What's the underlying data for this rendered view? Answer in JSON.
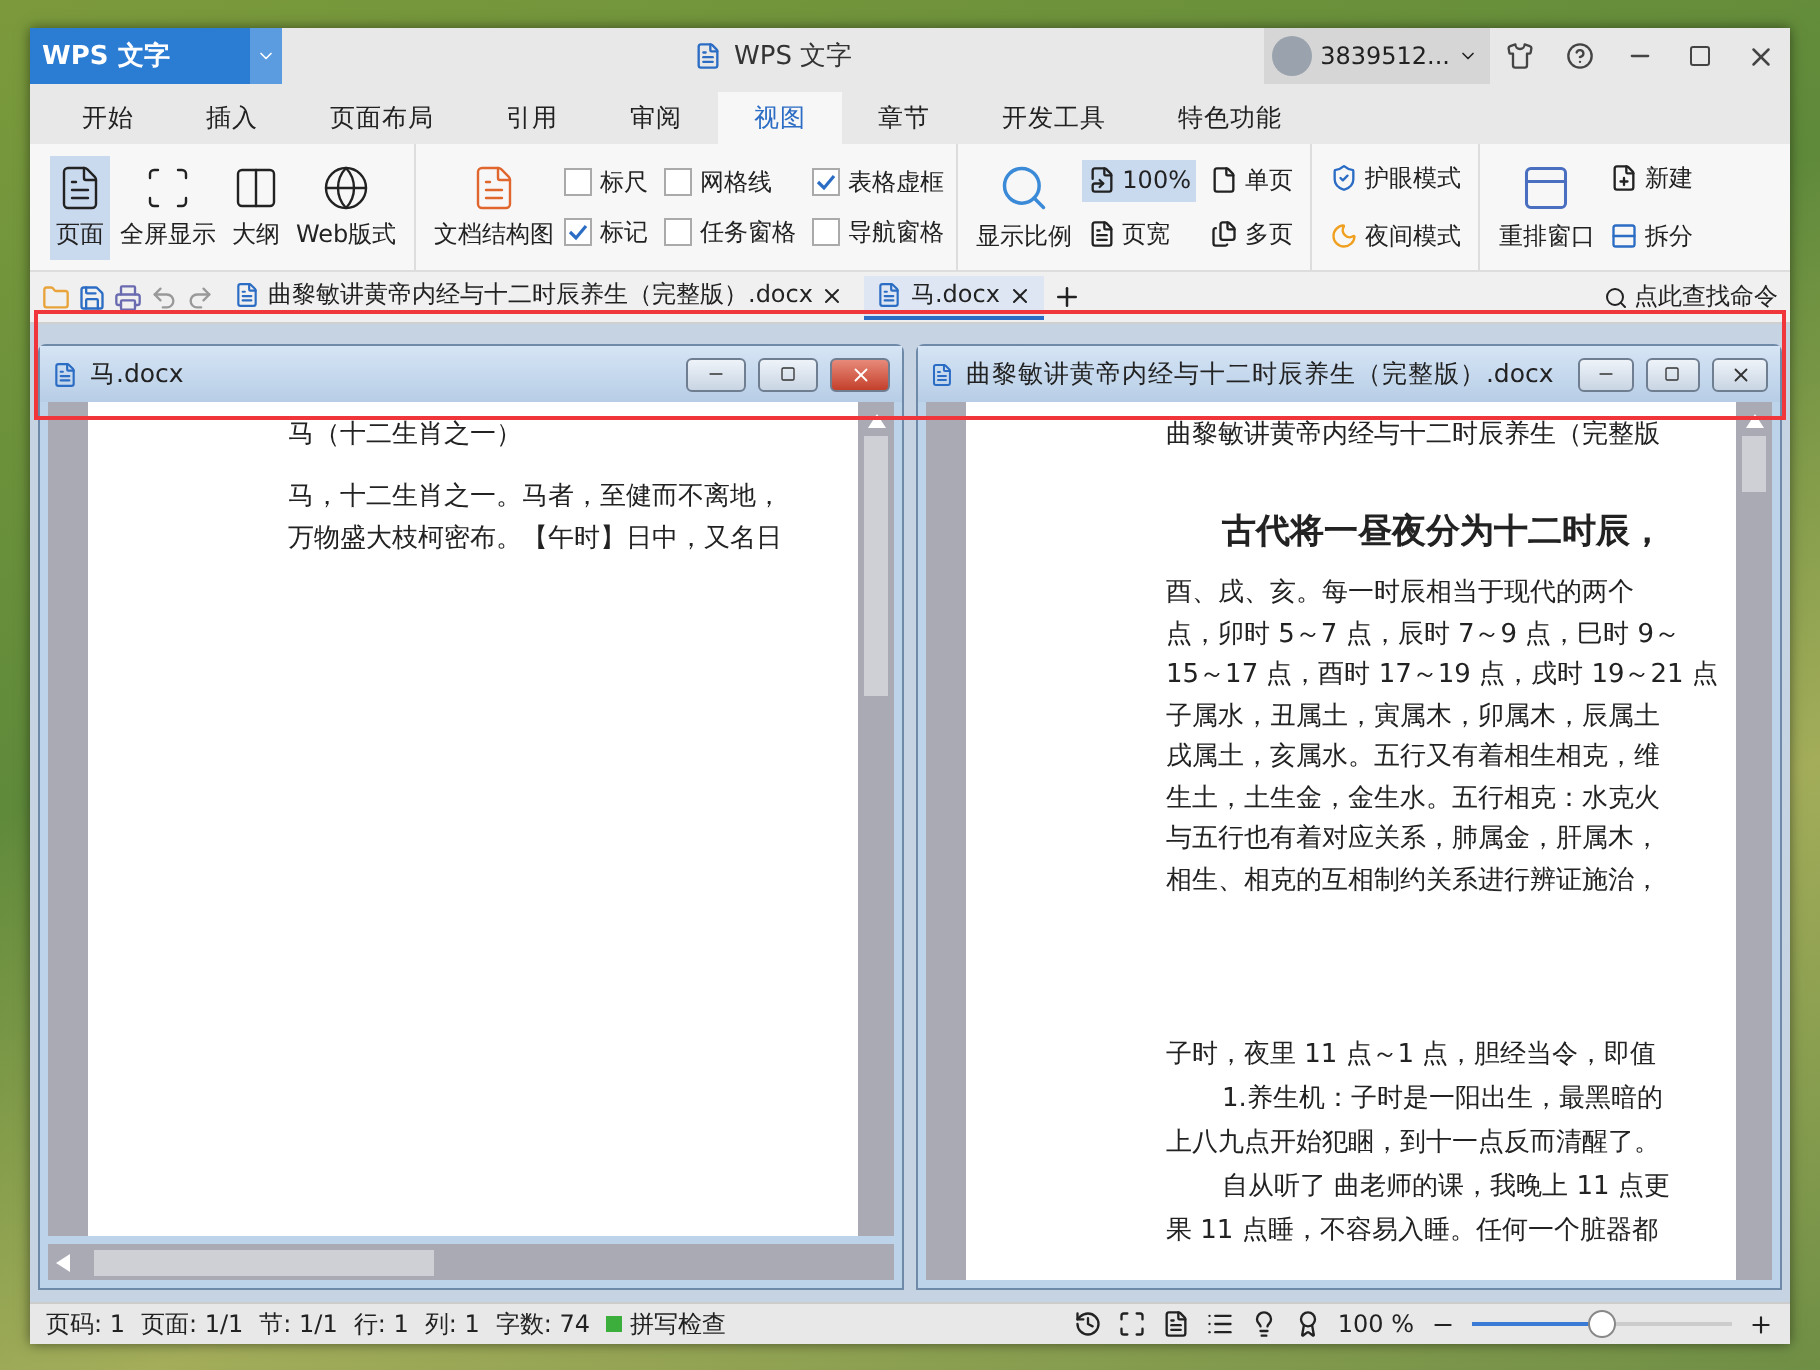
{
  "app": {
    "logo": "WPS 文字",
    "title": "WPS 文字",
    "user": "3839512..."
  },
  "menu_tabs": [
    {
      "label": "开始",
      "selected": false
    },
    {
      "label": "插入",
      "selected": false
    },
    {
      "label": "页面布局",
      "selected": false
    },
    {
      "label": "引用",
      "selected": false
    },
    {
      "label": "审阅",
      "selected": false
    },
    {
      "label": "视图",
      "selected": true
    },
    {
      "label": "章节",
      "selected": false
    },
    {
      "label": "开发工具",
      "selected": false
    },
    {
      "label": "特色功能",
      "selected": false
    }
  ],
  "ribbon": {
    "views": [
      {
        "label": "页面",
        "selected": true
      },
      {
        "label": "全屏显示",
        "selected": false
      },
      {
        "label": "大纲",
        "selected": false
      },
      {
        "label": "Web版式",
        "selected": false
      }
    ],
    "doc_map": "文档结构图",
    "checks": [
      {
        "label": "标尺",
        "checked": false
      },
      {
        "label": "网格线",
        "checked": false
      },
      {
        "label": "表格虚框",
        "checked": true
      },
      {
        "label": "标记",
        "checked": true
      },
      {
        "label": "任务窗格",
        "checked": false
      },
      {
        "label": "导航窗格",
        "checked": false
      }
    ],
    "zoom_label": "显示比例",
    "zoom_buttons": [
      {
        "label": "100%",
        "selected": true
      },
      {
        "label": "单页",
        "selected": false
      },
      {
        "label": "页宽",
        "selected": false
      },
      {
        "label": "多页",
        "selected": false
      }
    ],
    "modes": [
      "护眼模式",
      "夜间模式"
    ],
    "arrange": "重排窗口",
    "extra": [
      "新建",
      "拆分"
    ]
  },
  "doc_tabs": [
    {
      "label": "曲黎敏讲黄帝内经与十二时辰养生（完整版）.docx",
      "selected": false
    },
    {
      "label": "马.docx",
      "selected": true
    }
  ],
  "search_command": "点此查找命令",
  "windows": [
    {
      "title": "马.docx",
      "active": true,
      "blocks": [
        {
          "kind": "title",
          "lines": [
            {
              "text": "马（十二生肖之一）",
              "indent": false
            }
          ]
        },
        {
          "kind": "body",
          "lines": [
            {
              "text": "马，十二生肖之一。马者，至健而不离地，",
              "indent": false
            },
            {
              "text": "万物盛大枝柯密布。【午时】日中，又名日",
              "indent": false
            }
          ]
        }
      ]
    },
    {
      "title": "曲黎敏讲黄帝内经与十二时辰养生（完整版）.docx",
      "active": false,
      "blocks": [
        {
          "kind": "title",
          "lines": [
            {
              "text": "曲黎敏讲黄帝内经与十二时辰养生（完整版",
              "indent": false
            }
          ]
        },
        {
          "kind": "heading",
          "lines": [
            {
              "text": "古代将一昼夜分为十二时辰，",
              "indent": true
            }
          ]
        },
        {
          "kind": "body",
          "lines": [
            {
              "text": "酉、戌、亥。每一时辰相当于现代的两个",
              "indent": false
            },
            {
              "text": "点，卯时 5～7 点，辰时 7～9 点，巳时 9～",
              "indent": false
            },
            {
              "text": "15～17 点，酉时 17～19 点，戌时 19～21 点",
              "indent": false
            },
            {
              "text": "子属水，丑属土，寅属木，卯属木，辰属土",
              "indent": false
            },
            {
              "text": "戌属土，亥属水。五行又有着相生相克，维",
              "indent": false
            },
            {
              "text": "生土，土生金，金生水。五行相克：水克火",
              "indent": false
            },
            {
              "text": "与五行也有着对应关系，肺属金，肝属木，",
              "indent": false
            },
            {
              "text": "相生、相克的互相制约关系进行辨证施治，",
              "indent": false
            }
          ]
        },
        {
          "kind": "section",
          "lines": [
            {
              "text": "子时，夜里 11 点～1 点，胆经当令，即值",
              "indent": false
            },
            {
              "text": "1.养生机：子时是一阳出生，最黑暗的",
              "indent": true
            },
            {
              "text": "上八九点开始犯睏，到十一点反而清醒了。",
              "indent": false
            },
            {
              "text": "自从听了 曲老师的课，我晚上 11 点更",
              "indent": true
            },
            {
              "text": "果 11 点睡，不容易入睡。任何一个脏器都",
              "indent": false
            }
          ]
        }
      ]
    }
  ],
  "status": {
    "items": [
      "页码: 1",
      "页面: 1/1",
      "节: 1/1",
      "行: 1",
      "列: 1",
      "字数: 74"
    ],
    "spell": "拼写检查",
    "zoom": "100 %",
    "level": 0.5
  }
}
